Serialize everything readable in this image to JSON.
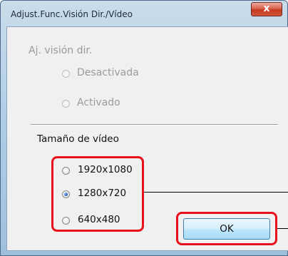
{
  "window": {
    "title": "Adjust.Func.Visión Dir./Vídeo",
    "close_glyph": "x"
  },
  "live_view_group": {
    "label": "Aj. visión dir.",
    "enabled": false,
    "options": [
      {
        "label": "Desactivada",
        "selected": false
      },
      {
        "label": "Activado",
        "selected": false
      }
    ]
  },
  "video_size_group": {
    "label": "Tamaño de vídeo",
    "options": [
      {
        "label": "1920x1080",
        "selected": false
      },
      {
        "label": "1280x720",
        "selected": true
      },
      {
        "label": "640x480",
        "selected": false
      }
    ]
  },
  "buttons": {
    "ok_label": "OK"
  },
  "colors": {
    "highlight": "#e8101a",
    "title_bar": "#aecce6",
    "dialog_background": "#f0f0f0"
  },
  "icons": {
    "close": "close-icon",
    "radio": "radio-button"
  }
}
